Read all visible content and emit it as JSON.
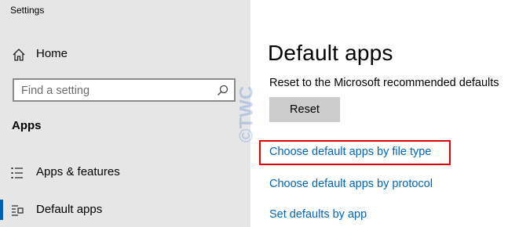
{
  "window": {
    "title": "Settings"
  },
  "sidebar": {
    "home_label": "Home",
    "search_placeholder": "Find a setting",
    "section_heading": "Apps",
    "items": [
      {
        "label": "Apps & features",
        "icon": "list-icon",
        "selected": false
      },
      {
        "label": "Default apps",
        "icon": "default-apps-icon",
        "selected": true
      }
    ]
  },
  "main": {
    "title": "Default apps",
    "reset_description": "Reset to the Microsoft recommended defaults",
    "reset_button": "Reset",
    "links": [
      {
        "label": "Choose default apps by file type",
        "highlighted": true
      },
      {
        "label": "Choose default apps by protocol",
        "highlighted": false
      },
      {
        "label": "Set defaults by app",
        "highlighted": false
      }
    ]
  },
  "colors": {
    "sidebar_bg": "#e6e6e6",
    "accent": "#0063b1",
    "link": "#0067b8",
    "highlight": "#e00000",
    "button_bg": "#cccccc"
  },
  "watermark": {
    "text": "©TWC"
  }
}
